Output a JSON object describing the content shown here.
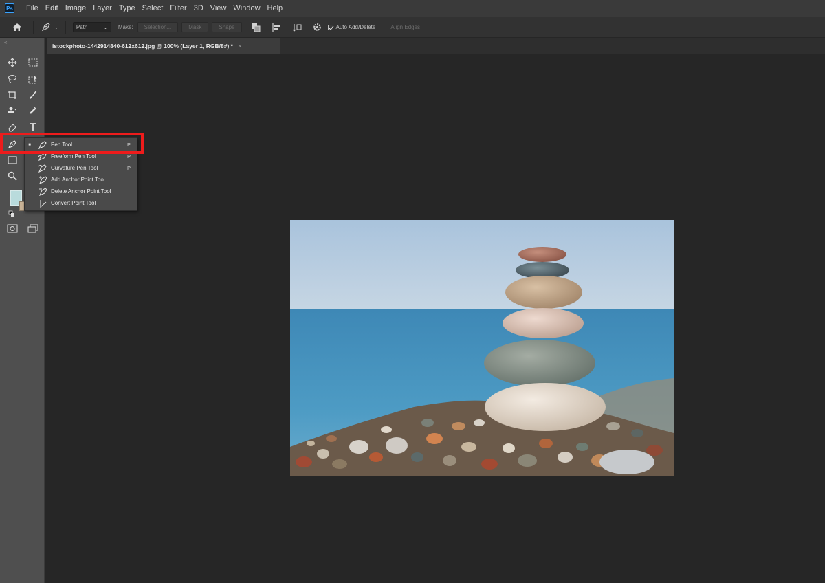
{
  "app": {
    "logo": "Ps"
  },
  "menu": [
    "File",
    "Edit",
    "Image",
    "Layer",
    "Type",
    "Select",
    "Filter",
    "3D",
    "View",
    "Window",
    "Help"
  ],
  "options_bar": {
    "mode_select": "Path",
    "make_label": "Make:",
    "selection_btn": "Selection...",
    "mask_btn": "Mask",
    "shape_btn": "Shape",
    "auto_add_delete_label": "Auto Add/Delete",
    "auto_add_delete_checked": true,
    "align_edges_label": "Align Edges"
  },
  "document_tab": {
    "title": "istockphoto-1442914840-612x612.jpg @ 100% (Layer 1, RGB/8#) *",
    "close": "×"
  },
  "pen_flyout": {
    "items": [
      {
        "label": "Pen Tool",
        "shortcut": "P",
        "active": true
      },
      {
        "label": "Freeform Pen Tool",
        "shortcut": "P",
        "active": false
      },
      {
        "label": "Curvature Pen Tool",
        "shortcut": "P",
        "active": false
      },
      {
        "label": "Add Anchor Point Tool",
        "shortcut": "",
        "active": false
      },
      {
        "label": "Delete Anchor Point Tool",
        "shortcut": "",
        "active": false
      },
      {
        "label": "Convert Point Tool",
        "shortcut": "",
        "active": false
      }
    ]
  },
  "colors": {
    "highlight": "#ee1c1c",
    "foreground_swatch": "#b9dbdc",
    "background_swatch": "#c9b397"
  }
}
